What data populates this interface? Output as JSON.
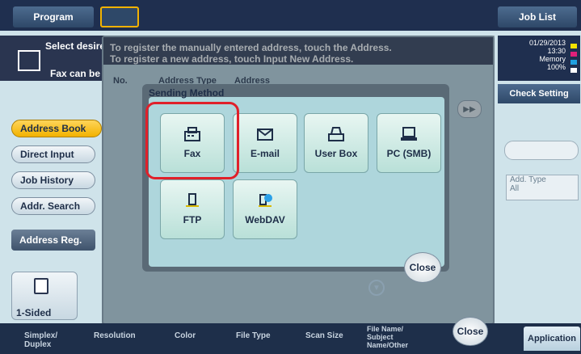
{
  "topbar": {
    "program_label": "Program",
    "joblist_label": "Job List"
  },
  "left": {
    "message_line1": "Select desire",
    "message_line2": "Fax can be s",
    "buttons": [
      {
        "label": "Address Book",
        "active": true
      },
      {
        "label": "Direct Input",
        "active": false
      },
      {
        "label": "Job History",
        "active": false
      },
      {
        "label": "Addr. Search",
        "active": false
      }
    ],
    "addr_reg_label": "Address Reg.",
    "simplex_value": "1-Sided"
  },
  "status": {
    "date": "01/29/2013",
    "time": "13:30",
    "memory_label": "Memory",
    "memory_value": "100%",
    "cmyk": [
      "Y",
      "M",
      "C",
      "K"
    ],
    "check_setting_label": "Check Setting",
    "add_type_label": "Add. Type",
    "add_type_value": "All"
  },
  "dialog": {
    "message_line1": "To register the manually entered address, touch the Address.",
    "message_line2": "To register a new address, touch Input New Address.",
    "col_no": "No.",
    "col_type": "Address Type",
    "col_addr": "Address",
    "close_label": "Close"
  },
  "popup": {
    "title": "Sending Method",
    "methods": [
      {
        "label": "Fax",
        "icon": "fax-icon"
      },
      {
        "label": "E-mail",
        "icon": "email-icon"
      },
      {
        "label": "User Box",
        "icon": "user-box-icon"
      },
      {
        "label": "PC (SMB)",
        "icon": "pc-icon"
      },
      {
        "label": "FTP",
        "icon": "ftp-icon"
      },
      {
        "label": "WebDAV",
        "icon": "webdav-icon"
      }
    ],
    "close_label": "Close"
  },
  "bottom": {
    "tabs": [
      "Simplex/\nDuplex",
      "Resolution",
      "Color",
      "File Type",
      "Scan Size",
      "File Name/\nSubject\nName/Other"
    ],
    "application_label": "Application"
  }
}
